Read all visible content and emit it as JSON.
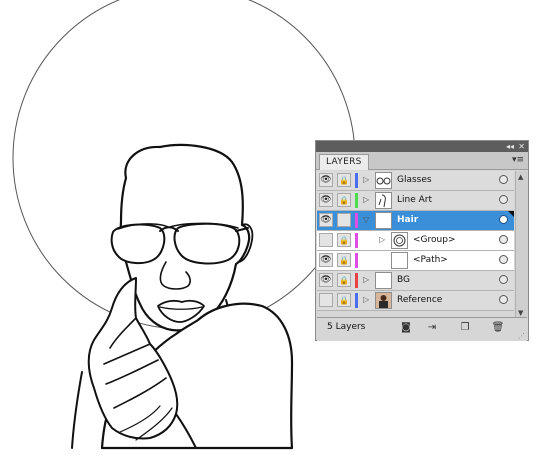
{
  "panel": {
    "tab_label": "LAYERS",
    "title_controls": "◂◂ ✕",
    "menu_icon": "menu-icon",
    "footer": {
      "layer_count": "5 Layers",
      "buttons": [
        "make-clip-mask",
        "create-sublayer",
        "create-layer",
        "delete"
      ]
    },
    "rows": [
      {
        "name": "Glasses",
        "visible": true,
        "locked": true,
        "color": "#4a6ef2",
        "expanded": false,
        "selected": false,
        "thumb": "glasses"
      },
      {
        "name": "Line Art",
        "visible": true,
        "locked": true,
        "color": "#4adf4a",
        "expanded": false,
        "selected": false,
        "thumb": "figure"
      },
      {
        "name": "Hair",
        "visible": true,
        "locked": false,
        "color": "#e04de6",
        "expanded": true,
        "selected": true,
        "thumb": "blank"
      },
      {
        "name": "<Group>",
        "visible": false,
        "locked": true,
        "color": "#e04de6",
        "expanded": false,
        "selected": false,
        "thumb": "circle",
        "sub": true
      },
      {
        "name": "<Path>",
        "visible": true,
        "locked": true,
        "color": "#e04de6",
        "expanded": false,
        "selected": false,
        "thumb": "blank",
        "sub": true
      },
      {
        "name": "BG",
        "visible": true,
        "locked": true,
        "color": "#e84242",
        "expanded": false,
        "selected": false,
        "thumb": "blank"
      },
      {
        "name": "Reference",
        "visible": false,
        "locked": true,
        "color": "#4a6ef2",
        "expanded": false,
        "selected": false,
        "thumb": "photo"
      }
    ]
  },
  "colors": {
    "selection": "#3a8fd8"
  }
}
